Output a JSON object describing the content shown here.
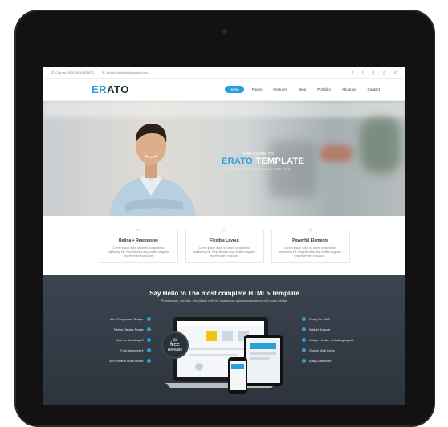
{
  "topbar": {
    "phone": "Call us: 1800 1000 ERATO",
    "email": "Email: contact@yoursite.com",
    "social_icons": [
      "facebook-icon",
      "twitter-icon",
      "google-plus-icon",
      "pinterest-icon",
      "linkedin-icon"
    ],
    "social_glyphs": [
      "f",
      "t",
      "g",
      "p",
      "in"
    ]
  },
  "header": {
    "logo_prefix": "ER",
    "logo_suffix": "ATO",
    "nav": [
      "Home",
      "Pages",
      "Features",
      "Blog",
      "Portfolio",
      "About us",
      "Contact"
    ],
    "active": "Home"
  },
  "hero": {
    "welcome": "WELCOME TO",
    "title_a": "ERATO",
    "title_b": " TEMPLATE",
    "subtitle": "THE MOST COMPLETE HTML5 TEMPLATE"
  },
  "features": [
    {
      "title": "Retina + Responsive",
      "text": "Lorem ipsum dolor sit amet, consectetur adipiscing elit. Repellendus aliq, mollita magnam reprehenderit nesciunt."
    },
    {
      "title": "Flexible Layout",
      "text": "Lorem ipsum dolor sit amet, consectetur adipiscing elit. Repellendus aliq, mollita magnam reprehenderit nesciunt."
    },
    {
      "title": "Powerful Elements",
      "text": "Lorem ipsum dolor sit amet, consectetur adipiscing elit. Repellendus aliq, mollita magnam reprehenderit nesciunt."
    }
  ],
  "promo": {
    "title": "Say Hello to The most complete HTML5 Template",
    "subtitle": "Praesentium, veritatis, voluptatum velit, hic laudantium quia recusandae eveniet quam beatae",
    "left_list": [
      "Ultra Responsive Design",
      "Retina Display Ready",
      "Base on Bootstrap 3",
      "Font Awesome 4",
      "450+ Retina Icons Addon"
    ],
    "right_list": [
      "Ready for CMS",
      "Widget Support",
      "Unique Header - Heading Layout",
      "Google Web Fonts",
      "Easy Customize"
    ],
    "free_label": "free",
    "free_sub": "Release"
  },
  "colors": {
    "accent": "#2aa0d8",
    "dark_bg": "#343b45",
    "tablet": "#121212"
  }
}
